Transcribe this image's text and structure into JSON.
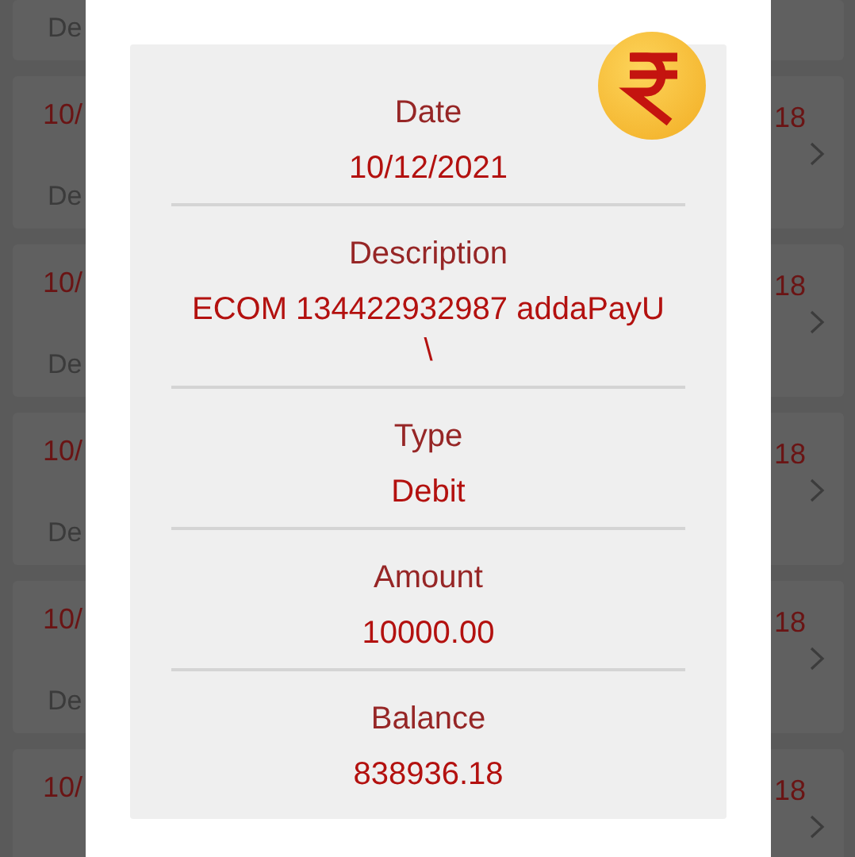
{
  "background_list": {
    "rows": [
      {
        "description": "De"
      },
      {
        "date": "10/",
        "description": "De",
        "amount": "18"
      },
      {
        "date": "10/",
        "description": "De",
        "amount": "18"
      },
      {
        "date": "10/",
        "description": "De",
        "amount": "18"
      },
      {
        "date": "10/",
        "description": "De",
        "amount": "18"
      },
      {
        "date": "10/",
        "amount": "18"
      }
    ]
  },
  "dialog": {
    "fields": [
      {
        "label": "Date",
        "value": "10/12/2021"
      },
      {
        "label": "Description",
        "value": "ECOM 134422932987 addaPayU \\"
      },
      {
        "label": "Type",
        "value": "Debit"
      },
      {
        "label": "Amount",
        "value": "10000.00"
      },
      {
        "label": "Balance",
        "value": "838936.18"
      }
    ]
  }
}
